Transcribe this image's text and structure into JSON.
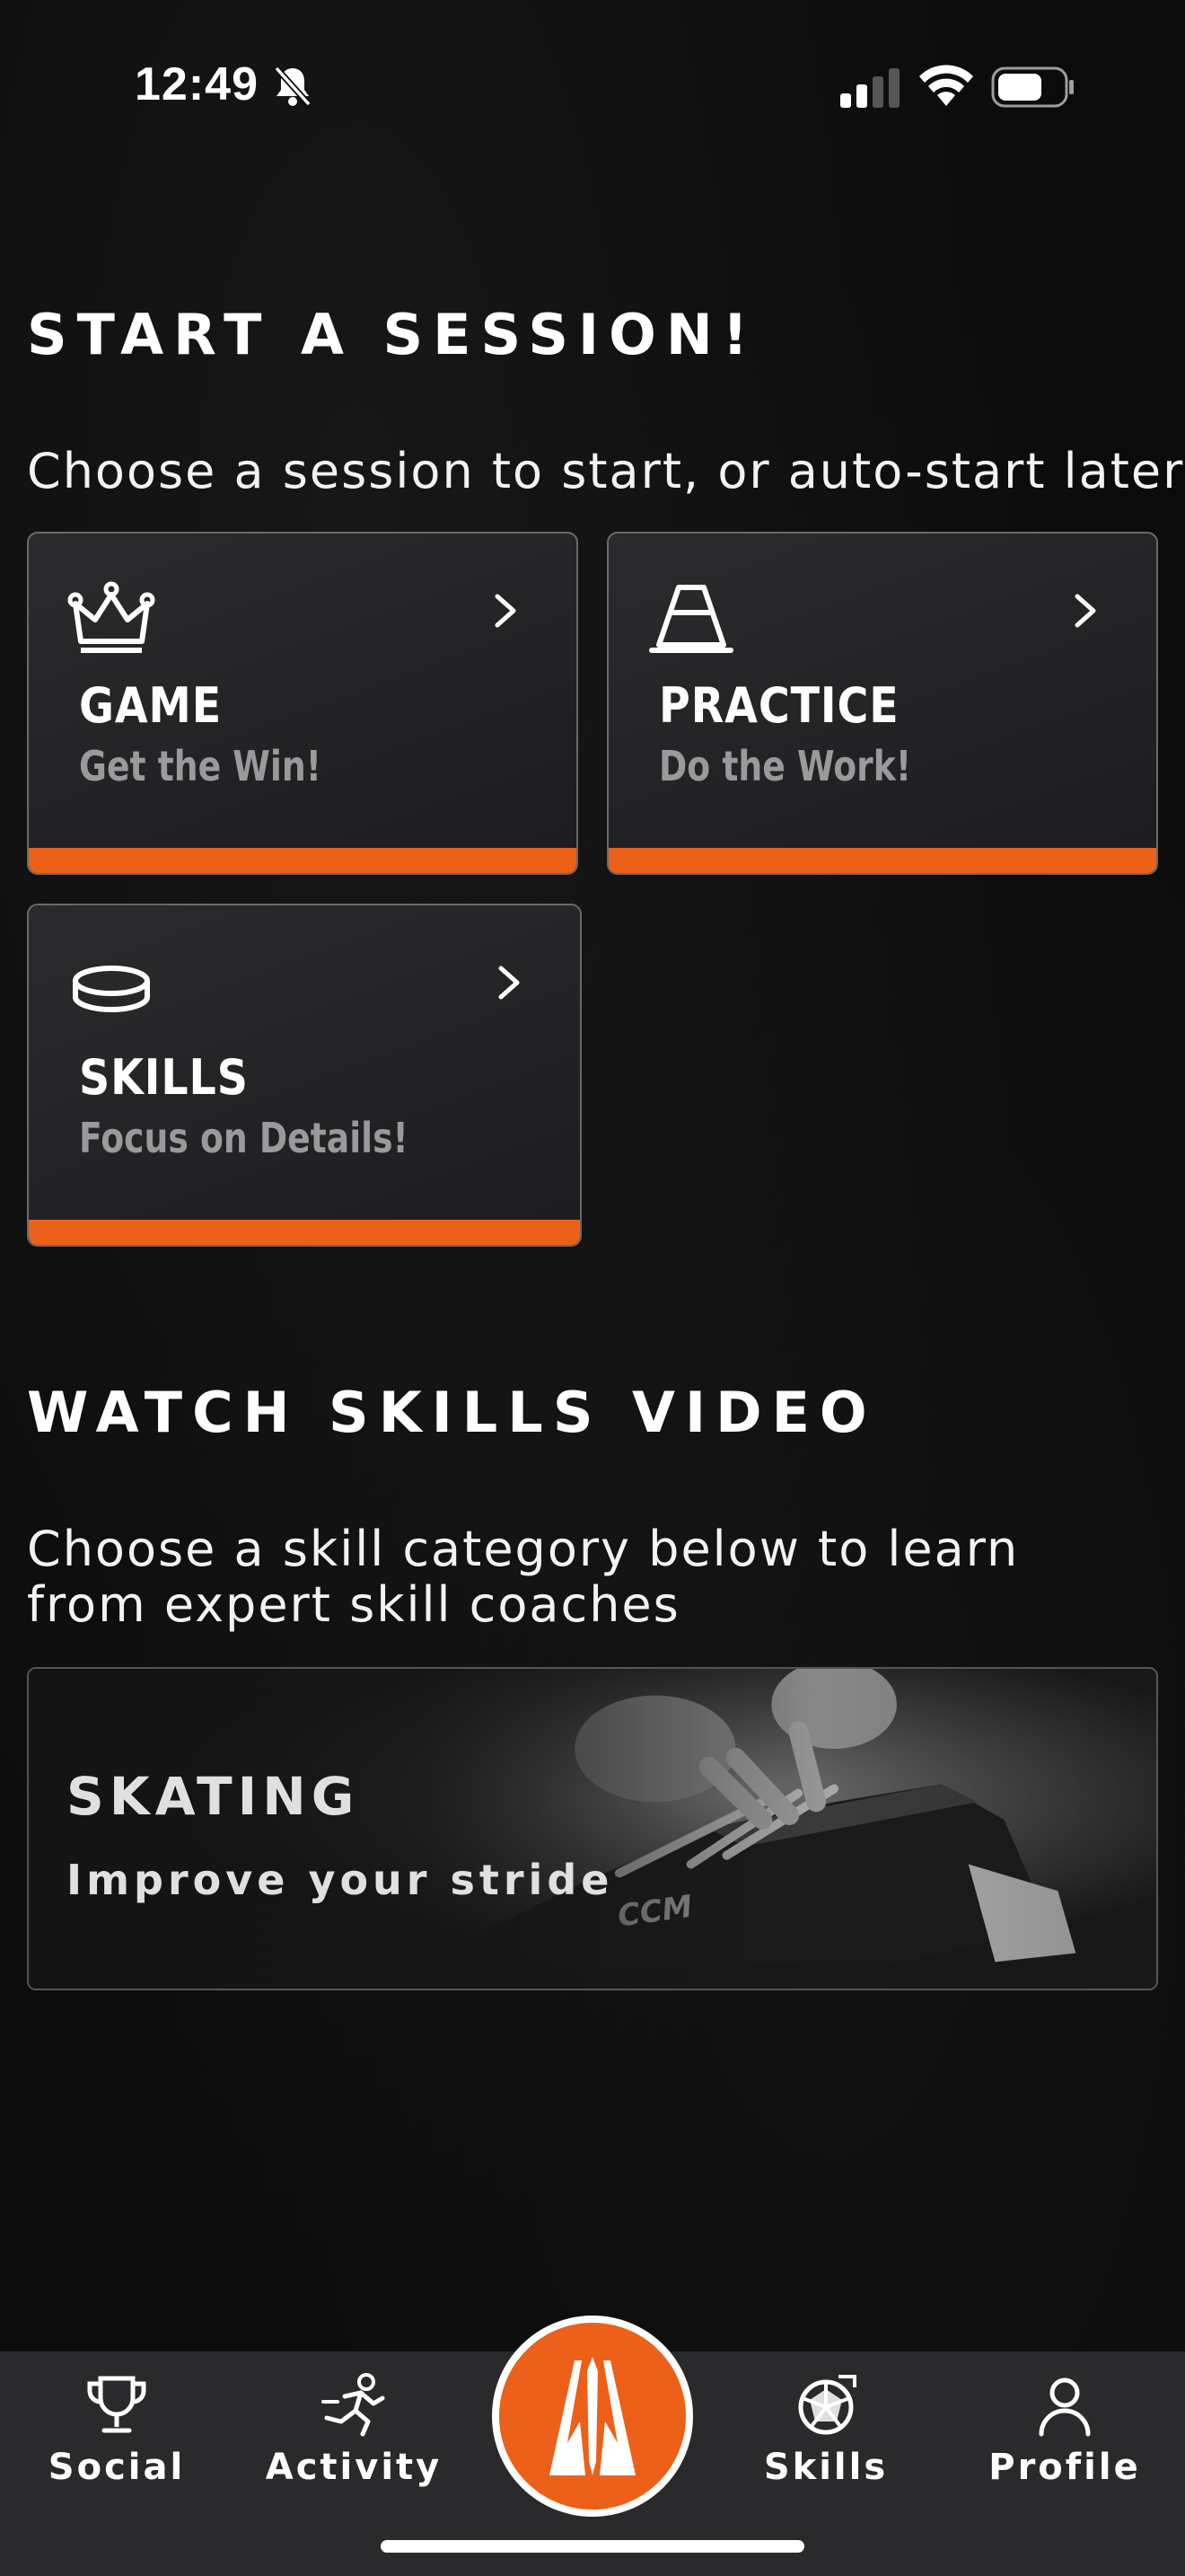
{
  "status_bar": {
    "time": "12:49"
  },
  "start_session": {
    "title": "START A SESSION!",
    "subtitle": "Choose a session to start, or auto-start later",
    "cards": [
      {
        "icon": "crown-icon",
        "title": "GAME",
        "subtitle": "Get the Win!"
      },
      {
        "icon": "cone-icon",
        "title": "PRACTICE",
        "subtitle": "Do the Work!"
      },
      {
        "icon": "puck-icon",
        "title": "SKILLS",
        "subtitle": "Focus on Details!"
      }
    ],
    "accent_color": "#ec6019"
  },
  "skills_video": {
    "title": "WATCH SKILLS VIDEO",
    "subtitle": "Choose a skill category below to learn from expert skill coaches",
    "categories": [
      {
        "title": "SKATING",
        "subtitle": "Improve your stride",
        "image": "skate-lacing-photo"
      }
    ]
  },
  "tab_bar": {
    "items": [
      {
        "icon": "trophy-icon",
        "label": "Social"
      },
      {
        "icon": "running-icon",
        "label": "Activity"
      },
      {
        "icon": "app-logo-icon",
        "label": ""
      },
      {
        "icon": "radar-icon",
        "label": "Skills"
      },
      {
        "icon": "person-icon",
        "label": "Profile"
      }
    ]
  }
}
